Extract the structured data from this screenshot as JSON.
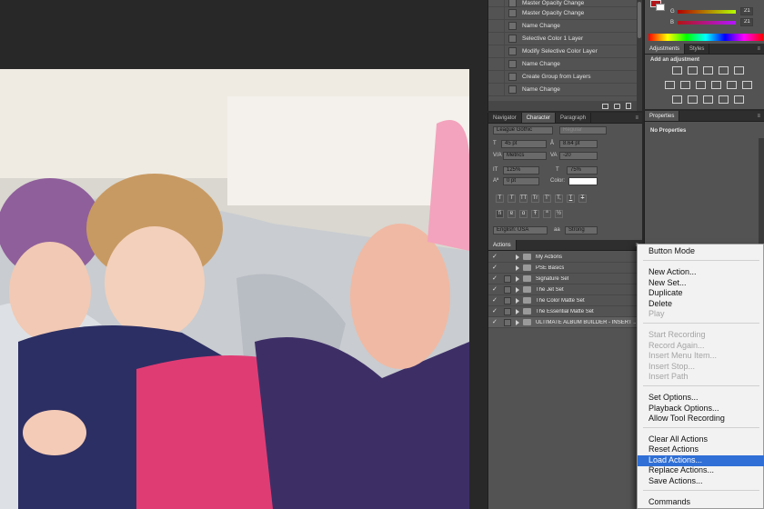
{
  "history": {
    "steps": [
      "Master Opacity Change",
      "Master Opacity Change",
      "Name Change",
      "Selective Color 1 Layer",
      "Modify Selective Color Layer",
      "Name Change",
      "Create Group from Layers",
      "Name Change"
    ]
  },
  "color_panel": {
    "channels": [
      {
        "label": "G",
        "value": "21"
      },
      {
        "label": "B",
        "value": "21"
      }
    ],
    "foreground": "#b3161b",
    "background": "#ffffff"
  },
  "adjustments": {
    "tabs": [
      "Adjustments",
      "Styles"
    ],
    "active_tab": "Adjustments",
    "heading": "Add an adjustment",
    "icons": [
      "brightness-contrast-icon",
      "levels-icon",
      "curves-icon",
      "exposure-icon",
      "vibrance-icon",
      "hue-saturation-icon",
      "color-balance-icon",
      "black-white-icon",
      "photo-filter-icon",
      "channel-mixer-icon",
      "color-lookup-icon",
      "invert-icon",
      "posterize-icon",
      "threshold-icon",
      "gradient-map-icon",
      "selective-color-icon"
    ]
  },
  "properties": {
    "title": "Properties",
    "message": "No Properties"
  },
  "character": {
    "tabs": [
      "Navigator",
      "Character",
      "Paragraph"
    ],
    "active_tab": "Character",
    "font_family": "League Gothic",
    "font_style": "Regular",
    "font_size": "45 pt",
    "leading": "8.64 pt",
    "kerning": "Metrics",
    "tracking": "-20",
    "vertical_scale": "125%",
    "horizontal_scale": "75%",
    "baseline_shift": "0 pt",
    "color_label": "Color:",
    "language": "English: USA",
    "antialias": "Strong",
    "type_glyphs": [
      "T",
      "T",
      "TT",
      "Tr",
      "T'",
      "T,",
      "T",
      "T"
    ]
  },
  "actions": {
    "tab": "Actions",
    "sets": [
      "My Actions",
      "PSE Basics",
      "Signature Set",
      "The Jet Set",
      "The Color Matte Set",
      "The Essential Matte Set",
      "ULTIMATE ALBUM BUILDER - INSERT ..."
    ]
  },
  "context_menu": {
    "items": [
      {
        "label": "Button Mode",
        "enabled": true
      },
      {
        "label": "New Action...",
        "enabled": true
      },
      {
        "label": "New Set...",
        "enabled": true
      },
      {
        "label": "Duplicate",
        "enabled": true
      },
      {
        "label": "Delete",
        "enabled": true
      },
      {
        "label": "Play",
        "enabled": false
      },
      {
        "label": "Start Recording",
        "enabled": false
      },
      {
        "label": "Record Again...",
        "enabled": false
      },
      {
        "label": "Insert Menu Item...",
        "enabled": false
      },
      {
        "label": "Insert Stop...",
        "enabled": false
      },
      {
        "label": "Insert Path",
        "enabled": false
      },
      {
        "label": "Set Options...",
        "enabled": true
      },
      {
        "label": "Playback Options...",
        "enabled": true
      },
      {
        "label": "Allow Tool Recording",
        "enabled": true
      },
      {
        "label": "Clear All Actions",
        "enabled": true
      },
      {
        "label": "Reset Actions",
        "enabled": true
      },
      {
        "label": "Load Actions...",
        "enabled": true,
        "selected": true
      },
      {
        "label": "Replace Actions...",
        "enabled": true
      },
      {
        "label": "Save Actions...",
        "enabled": true
      },
      {
        "label": "Commands",
        "enabled": true
      }
    ]
  },
  "colors": {
    "panel_bg": "#535353",
    "menu_highlight": "#2f6fd6"
  }
}
